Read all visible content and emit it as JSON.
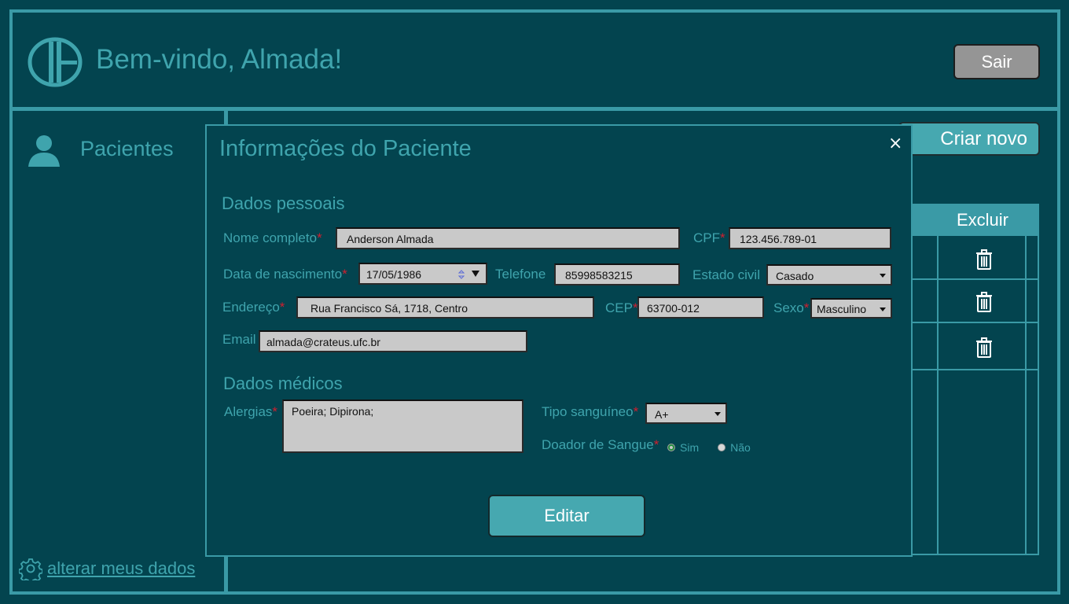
{
  "header": {
    "welcome": "Bem-vindo, Almada!",
    "logout_label": "Sair"
  },
  "sidebar": {
    "patients_label": "Pacientes",
    "settings_link": "alterar meus dados"
  },
  "main": {
    "create_button": "Criar novo",
    "table_header_delete": "Excluir"
  },
  "modal": {
    "title": "Informações do Paciente",
    "close_glyph": "×",
    "personal_section": "Dados pessoais",
    "medical_section": "Dados médicos",
    "required_mark": "*",
    "labels": {
      "full_name": "Nome completo",
      "cpf": "CPF",
      "birth_date": "Data de nascimento",
      "phone": "Telefone",
      "marital_status": "Estado civil",
      "address": "Endereço",
      "cep": "CEP",
      "sex": "Sexo",
      "email": "Email",
      "allergies": "Alergias",
      "blood_type": "Tipo sanguíneo",
      "blood_donor": "Doador de Sangue"
    },
    "values": {
      "full_name": "Anderson Almada",
      "cpf": "123.456.789-01",
      "birth_date": "17/05/1986",
      "phone": "85998583215",
      "marital_status": "Casado",
      "address": "Rua Francisco Sá, 1718, Centro",
      "cep": "63700-012",
      "sex": "Masculino",
      "email": "almada@crateus.ufc.br",
      "allergies": "Poeira; Dipirona;",
      "blood_type": "A+"
    },
    "donor_options": {
      "yes": "Sim",
      "no": "Não"
    },
    "donor_selected": "Sim",
    "edit_button": "Editar"
  },
  "colors": {
    "background": "#03444f",
    "accent": "#3a9aa6",
    "text": "#3fa4ad",
    "button": "#46a8b0",
    "required": "#d11f2f",
    "field": "#c9c9c9"
  },
  "icons": [
    "logo-icon",
    "user-icon",
    "gear-icon",
    "trash-icon",
    "close-icon",
    "calendar-spinner-icon",
    "chevron-down-icon"
  ]
}
